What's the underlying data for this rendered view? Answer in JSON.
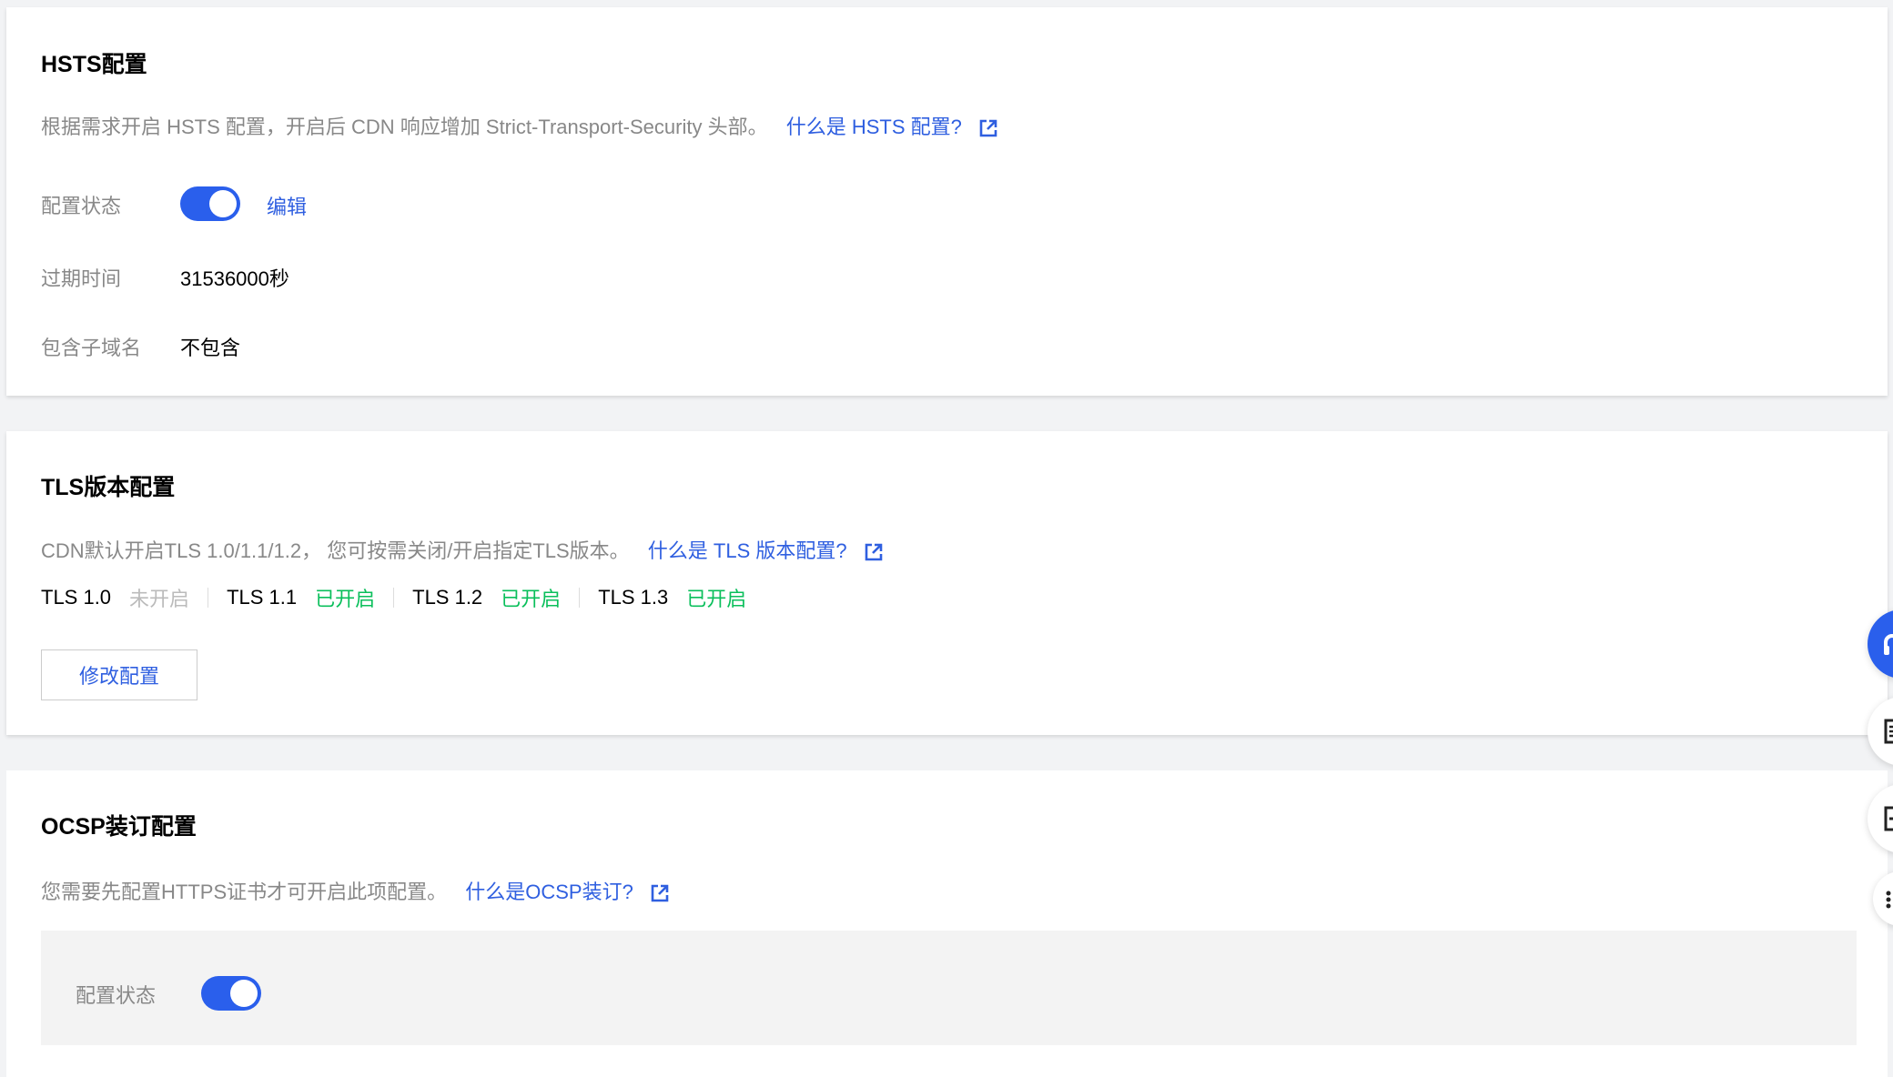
{
  "hsts": {
    "title": "HSTS配置",
    "desc_text": "根据需求开启 HSTS 配置，开启后 CDN 响应增加 Strict-Transport-Security 头部。",
    "desc_link": "什么是 HSTS 配置?",
    "status_label": "配置状态",
    "toggle_on": true,
    "edit_label": "编辑",
    "expire_label": "过期时间",
    "expire_value": "31536000秒",
    "subdomain_label": "包含子域名",
    "subdomain_value": "不包含"
  },
  "tls": {
    "title": "TLS版本配置",
    "desc_text": "CDN默认开启TLS 1.0/1.1/1.2， 您可按需关闭/开启指定TLS版本。",
    "desc_link": "什么是 TLS 版本配置?",
    "versions": [
      {
        "name": "TLS 1.0",
        "status": "未开启",
        "enabled": false
      },
      {
        "name": "TLS 1.1",
        "status": "已开启",
        "enabled": true
      },
      {
        "name": "TLS 1.2",
        "status": "已开启",
        "enabled": true
      },
      {
        "name": "TLS 1.3",
        "status": "已开启",
        "enabled": true
      }
    ],
    "modify_button": "修改配置"
  },
  "ocsp": {
    "title": "OCSP装订配置",
    "desc_text": "您需要先配置HTTPS证书才可开启此项配置。",
    "desc_link": "什么是OCSP装订?",
    "status_label": "配置状态",
    "toggle_on": true
  },
  "colors": {
    "accent": "#2a5fec",
    "link": "#2f5fe0",
    "enabled": "#0abf5b",
    "disabled": "#bbbbbb"
  },
  "floating_icons": [
    "headset-icon",
    "document-icon",
    "feedback-icon",
    "more-icon"
  ]
}
